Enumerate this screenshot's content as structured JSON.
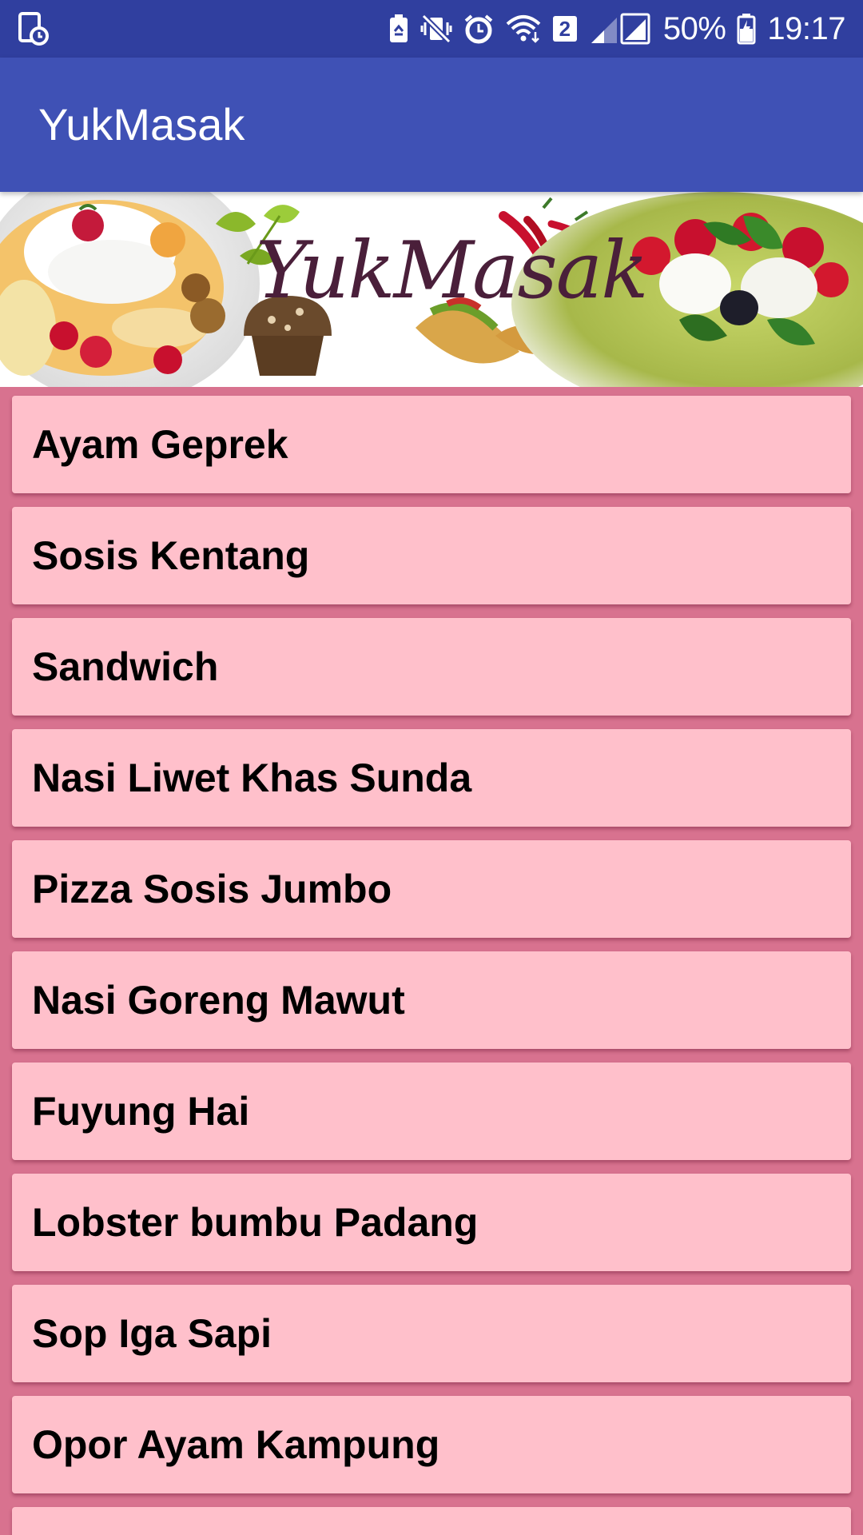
{
  "status_bar": {
    "battery_percent": "50%",
    "time": "19:17",
    "sim_badge": "2",
    "icons": [
      "screen-record-icon",
      "battery-saver-icon",
      "vibrate-icon",
      "alarm-icon",
      "wifi-icon",
      "signal-icon",
      "battery-icon"
    ]
  },
  "app_bar": {
    "title": "YukMasak"
  },
  "banner": {
    "title": "YukMasak"
  },
  "recipes": [
    "Ayam Geprek",
    "Sosis Kentang",
    "Sandwich",
    "Nasi Liwet Khas Sunda",
    "Pizza Sosis Jumbo",
    "Nasi Goreng Mawut",
    "Fuyung Hai",
    "Lobster bumbu Padang",
    "Sop Iga Sapi",
    "Opor Ayam Kampung",
    ""
  ],
  "colors": {
    "status_bar": "#303f9f",
    "app_bar": "#3f51b5",
    "list_background": "#d8728f",
    "item_background": "#ffc0cb",
    "banner_text": "#4a1f3a"
  }
}
